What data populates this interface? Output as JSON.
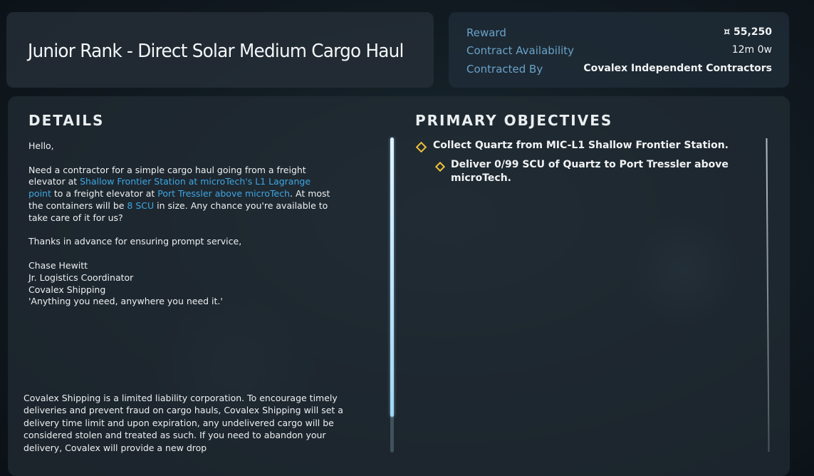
{
  "contract": {
    "title": "Junior Rank - Direct Solar Medium Cargo Haul"
  },
  "meta": {
    "reward_label": "Reward",
    "reward_value": "¤ 55,250",
    "availability_label": "Contract Availability",
    "availability_value": "12m 0w",
    "contracted_by_label": "Contracted By",
    "contracted_by_value": "Covalex Independent Contractors"
  },
  "details": {
    "heading": "DETAILS",
    "greeting": "Hello,",
    "body_1": "Need a contractor for a simple cargo haul going from a freight elevator at ",
    "link_pickup": "Shallow Frontier Station at microTech's L1 Lagrange point",
    "body_2": " to a freight elevator at ",
    "link_dropoff": "Port Tressler above microTech",
    "body_3": ". At most the containers will be ",
    "link_size": "8 SCU",
    "body_4": " in size. Any chance you're available to take care of it for us?",
    "thanks": "Thanks in advance for ensuring prompt service,",
    "sig_name": "Chase Hewitt",
    "sig_role": "Jr. Logistics Coordinator",
    "sig_company": "Covalex Shipping",
    "sig_motto": "'Anything you need, anywhere you need it.'",
    "disclaimer": "Covalex Shipping is a limited liability corporation. To encourage timely deliveries and prevent fraud on cargo hauls, Covalex Shipping will set a delivery time limit and upon expiration, any undelivered cargo will be considered stolen and treated as such. If you need to abandon your delivery, Covalex will provide a new drop"
  },
  "objectives": {
    "heading": "PRIMARY OBJECTIVES",
    "items": [
      {
        "text": "Collect Quartz from MIC-L1 Shallow Frontier Station."
      },
      {
        "text_line1": "Deliver 0/99 SCU of Quartz to Port Tressler above",
        "text_line2": "microTech."
      }
    ]
  },
  "colors": {
    "link": "#3fa6e3",
    "meta_label": "#6aa3c9",
    "objective_marker": "#f0c23a"
  },
  "icons": {
    "objective_marker": "diamond-outline-icon"
  }
}
